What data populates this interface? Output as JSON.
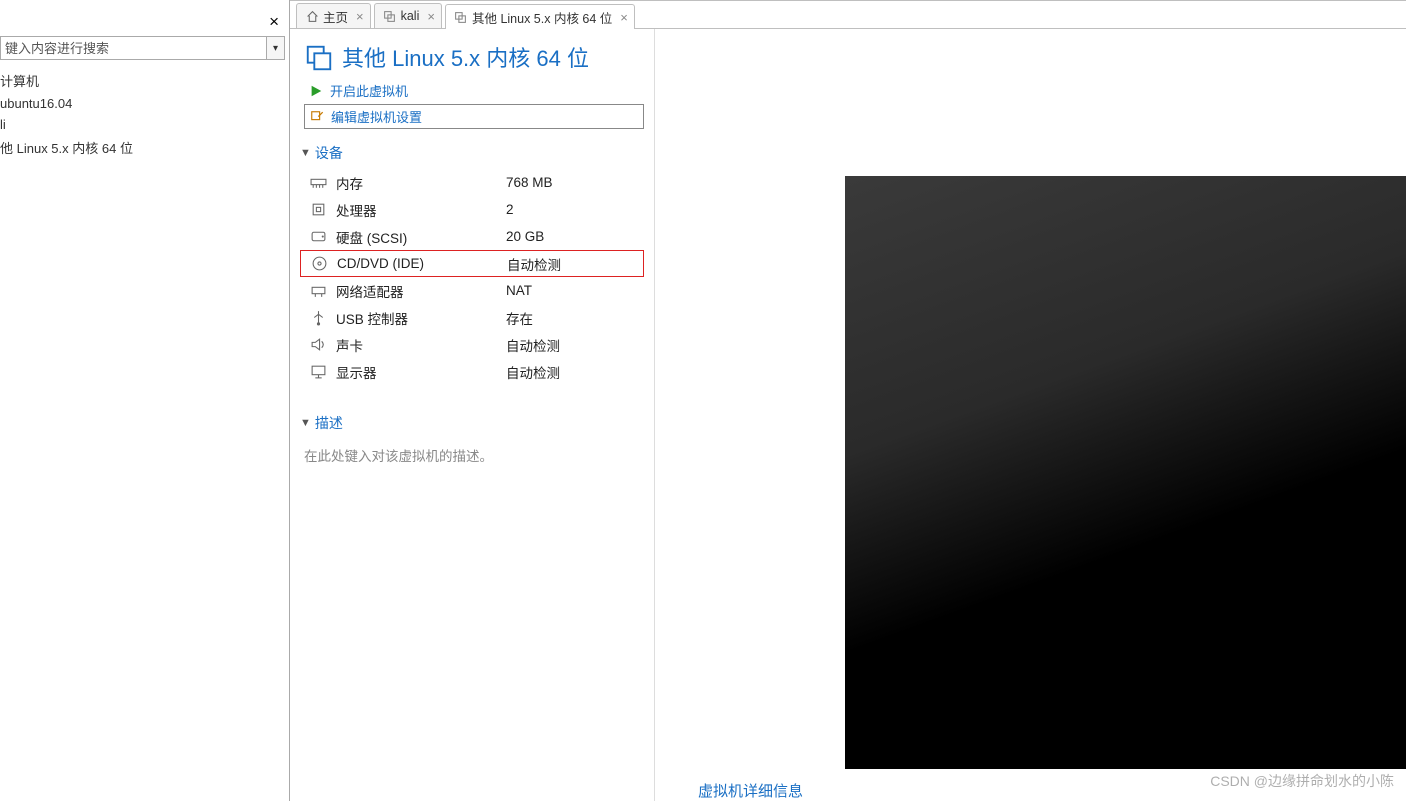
{
  "sidebar": {
    "search_placeholder": "键入内容进行搜索",
    "tree": [
      "计算机",
      "ubuntu16.04",
      "li",
      "他 Linux 5.x 内核 64 位"
    ]
  },
  "tabs": [
    {
      "label": "主页"
    },
    {
      "label": "kali"
    },
    {
      "label": "其他 Linux 5.x 内核 64 位"
    }
  ],
  "vm": {
    "title": "其他 Linux 5.x 内核 64 位",
    "power_on": "开启此虚拟机",
    "edit_settings": "编辑虚拟机设置",
    "devices_header": "设备",
    "devices": [
      {
        "icon": "memory",
        "label": "内存",
        "value": "768 MB"
      },
      {
        "icon": "cpu",
        "label": "处理器",
        "value": "2"
      },
      {
        "icon": "disk",
        "label": "硬盘 (SCSI)",
        "value": "20 GB"
      },
      {
        "icon": "cd",
        "label": "CD/DVD (IDE)",
        "value": "自动检测"
      },
      {
        "icon": "net",
        "label": "网络适配器",
        "value": "NAT"
      },
      {
        "icon": "usb",
        "label": "USB 控制器",
        "value": "存在"
      },
      {
        "icon": "sound",
        "label": "声卡",
        "value": "自动检测"
      },
      {
        "icon": "display",
        "label": "显示器",
        "value": "自动检测"
      }
    ],
    "desc_header": "描述",
    "desc_placeholder": "在此处键入对该虚拟机的描述。"
  },
  "footer_link": "虚拟机详细信息",
  "watermark": "CSDN @边缘拼命划水的小陈"
}
